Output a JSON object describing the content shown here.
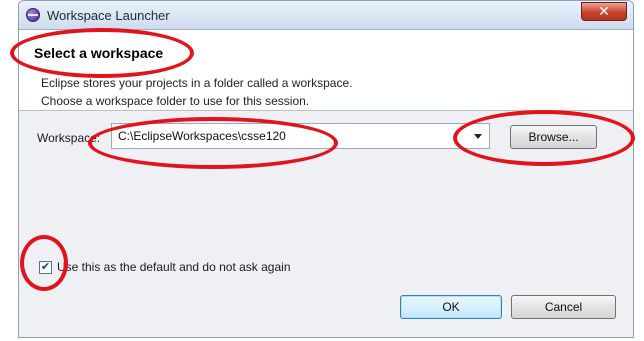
{
  "window": {
    "title": "Workspace Launcher",
    "close_glyph": "✕",
    "icon": "eclipse-icon"
  },
  "header": {
    "title": "Select a workspace",
    "description_lines": [
      "Eclipse stores your projects in a folder called a workspace.",
      "Choose a workspace folder to use for this session."
    ]
  },
  "workspace": {
    "label": "Workspace:",
    "value": "C:\\EclipseWorkspaces\\csse120",
    "dropdown_icon": "chevron-down-icon"
  },
  "buttons": {
    "browse": "Browse...",
    "ok": "OK",
    "cancel": "Cancel"
  },
  "default_option": {
    "checked": true,
    "check_glyph": "✔",
    "label": "Use this as the default and do not ask again"
  },
  "annotations": {
    "color": "#e4121b"
  }
}
